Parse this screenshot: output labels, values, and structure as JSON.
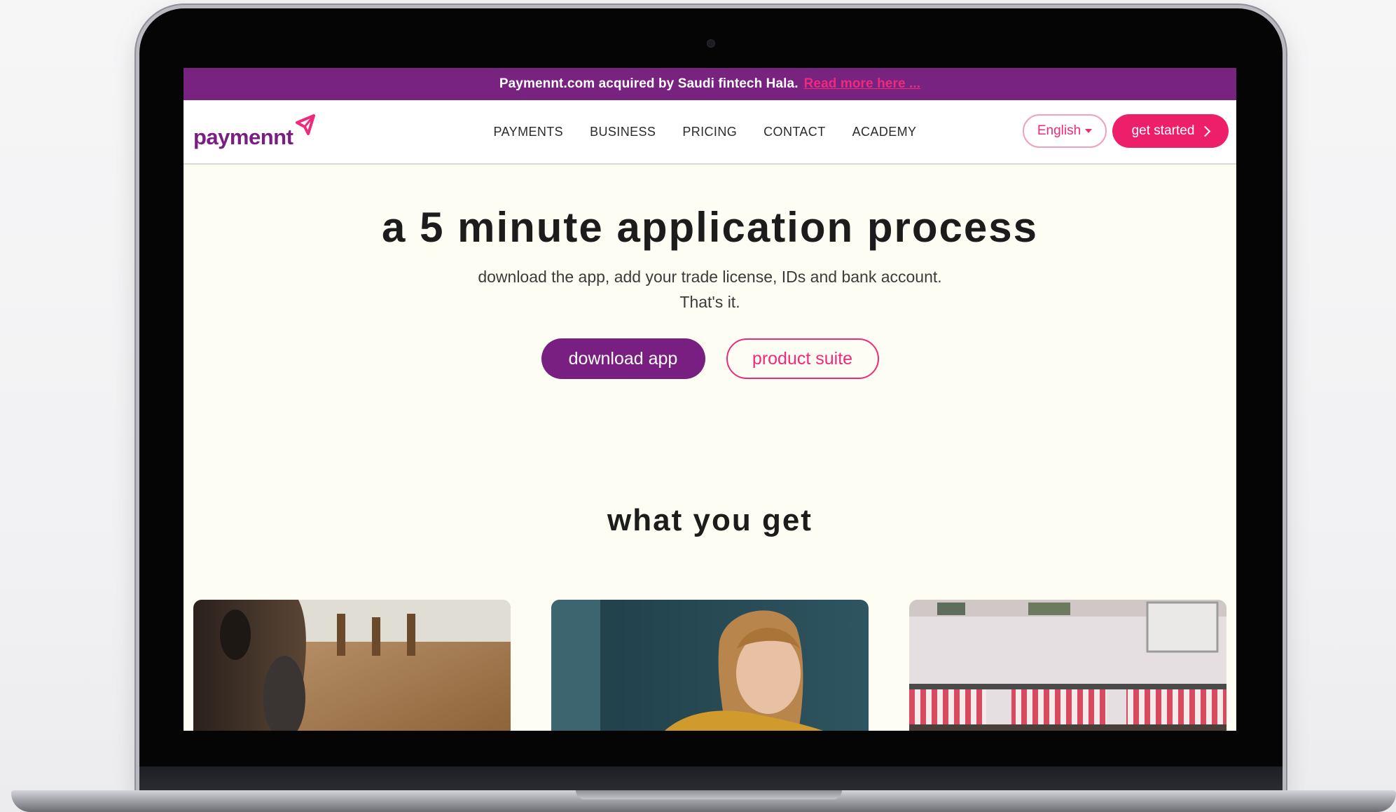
{
  "announcement": {
    "text": "Paymennt.com acquired by Saudi fintech Hala.",
    "link_text": "Read more here ..."
  },
  "logo": {
    "part1": "pay",
    "part2": "mennt",
    "icon": "paper-plane-icon"
  },
  "nav": {
    "items": [
      {
        "label": "PAYMENTS"
      },
      {
        "label": "BUSINESS"
      },
      {
        "label": "PRICING"
      },
      {
        "label": "CONTACT"
      },
      {
        "label": "ACADEMY"
      }
    ],
    "language": "English",
    "cta_label": "get started"
  },
  "hero": {
    "title": "a 5 minute application process",
    "subtitle": "download the app, add your trade license, IDs and bank account. That's it.",
    "primary_button": "download app",
    "secondary_button": "product suite"
  },
  "section": {
    "title": "what you get"
  },
  "colors": {
    "brand_purple": "#78237f",
    "brand_pink": "#ee1f6a",
    "page_background": "#fefdf3"
  }
}
